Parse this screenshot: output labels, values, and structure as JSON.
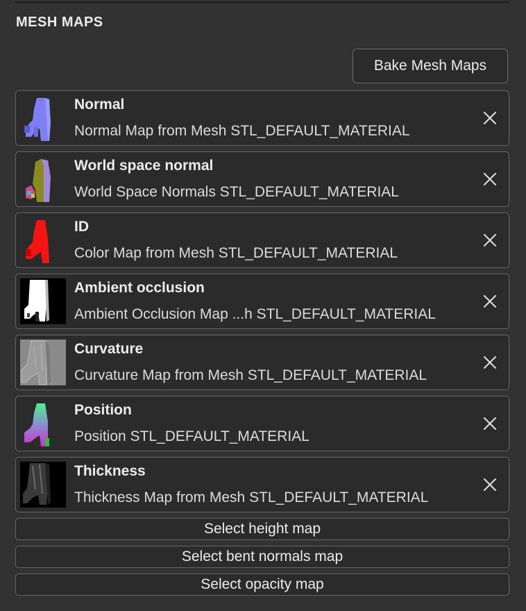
{
  "panel": {
    "title": "MESH MAPS"
  },
  "toolbar": {
    "bake_label": "Bake Mesh Maps"
  },
  "maps": [
    {
      "title": "Normal",
      "subtitle": "Normal Map from Mesh STL_DEFAULT_MATERIAL",
      "thumb": "normal"
    },
    {
      "title": "World space normal",
      "subtitle": "World Space Normals STL_DEFAULT_MATERIAL",
      "thumb": "world-normal"
    },
    {
      "title": "ID",
      "subtitle": "Color Map from Mesh STL_DEFAULT_MATERIAL",
      "thumb": "id"
    },
    {
      "title": "Ambient occlusion",
      "subtitle": "Ambient Occlusion Map ...h STL_DEFAULT_MATERIAL",
      "thumb": "ao"
    },
    {
      "title": "Curvature",
      "subtitle": "Curvature Map from Mesh STL_DEFAULT_MATERIAL",
      "thumb": "curvature"
    },
    {
      "title": "Position",
      "subtitle": "Position STL_DEFAULT_MATERIAL",
      "thumb": "position"
    },
    {
      "title": "Thickness",
      "subtitle": "Thickness Map from Mesh STL_DEFAULT_MATERIAL",
      "thumb": "thickness"
    }
  ],
  "select_buttons": [
    {
      "label": "Select height map"
    },
    {
      "label": "Select bent normals map"
    },
    {
      "label": "Select opacity map"
    }
  ],
  "icons": {
    "remove": "close-icon"
  },
  "colors": {
    "background": "#323232",
    "item_background": "#2b2b2b",
    "border": "#666666"
  }
}
